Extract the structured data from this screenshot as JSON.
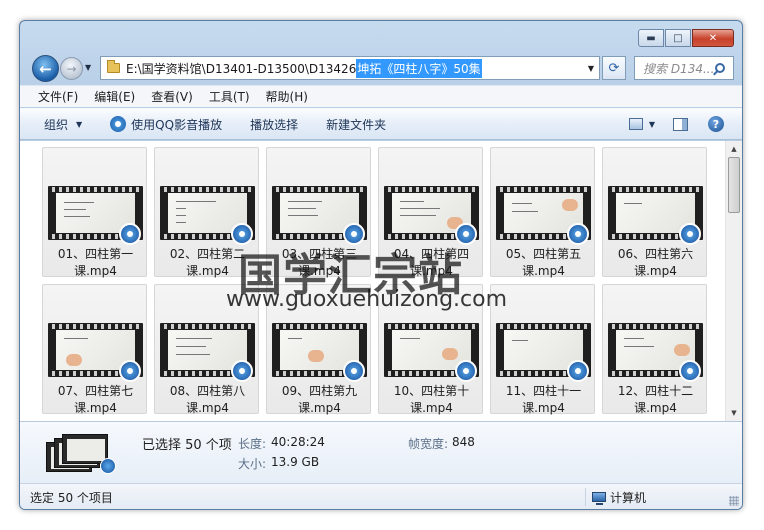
{
  "window": {
    "controls": {
      "minimize": "▬",
      "maximize": "□",
      "close": "✕"
    }
  },
  "address": {
    "path": "E:\\国学资料馆\\D13401-D13500\\D13426 ",
    "selected": "坤拓《四柱八字》50集",
    "search_placeholder": "搜索 D134..."
  },
  "menu": [
    "文件(F)",
    "编辑(E)",
    "查看(V)",
    "工具(T)",
    "帮助(H)"
  ],
  "toolbar": {
    "organize": "组织",
    "qq_player": "使用QQ影音播放",
    "play_selection": "播放选择",
    "new_folder": "新建文件夹"
  },
  "files": [
    "01、四柱第一课.mp4",
    "02、四柱第二课.mp4",
    "03、四柱第三课.mp4",
    "04、四柱第四课.mp4",
    "05、四柱第五课.mp4",
    "06、四柱第六课.mp4",
    "07、四柱第七课.mp4",
    "08、四柱第八课.mp4",
    "09、四柱第九课.mp4",
    "10、四柱第十课.mp4",
    "11、四柱十一课.mp4",
    "12、四柱十二课.mp4"
  ],
  "watermark": {
    "site_name": "国学汇宗站",
    "url": "www.guoxuehuizong.com"
  },
  "details": {
    "selected": "已选择 50 个项",
    "length_label": "长度:",
    "length_value": "40:28:24",
    "size_label": "大小:",
    "size_value": "13.9 GB",
    "frame_width_label": "帧宽度:",
    "frame_width_value": "848"
  },
  "status": {
    "left": "选定 50 个项目",
    "right": "计算机"
  }
}
